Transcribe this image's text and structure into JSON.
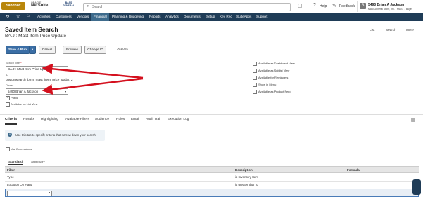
{
  "header": {
    "sandbox_label": "Sandbox",
    "oracle_label": "ORACLE",
    "netsuite_label": "NetSuite",
    "company_logo_text": "BASS GENERAL",
    "search_placeholder": "Search",
    "help_label": "Help",
    "feedback_label": "Feedback",
    "user_name": "5490 Brian A Jackson",
    "user_role": "Mast General Store, Inc. - MAST - Buyer",
    "user_initial": "B"
  },
  "nav": {
    "items": [
      "Activities",
      "Customers",
      "Vendors",
      "Financial",
      "Planning & Budgeting",
      "Reports",
      "Analytics",
      "Documents",
      "Setup",
      "Key Rec",
      "SuiteApps",
      "Support"
    ],
    "active_index": 3
  },
  "page": {
    "heading": "Saved Item Search",
    "record_title": "BA.J : Mast Item Price Update",
    "links": [
      "List",
      "Search",
      "More"
    ]
  },
  "toolbar": {
    "save_run": "Save & Run",
    "caret": "▾",
    "cancel": "Cancel",
    "preview": "Preview",
    "change_id": "Change ID",
    "actions": "Actions"
  },
  "form": {
    "search_title_label": "Search Title",
    "search_title_value": "BA.J : Mast Item Price Update",
    "id_label": "ID",
    "id_value": "customsearch_bmn_mast_item_price_updat_2",
    "owner_label": "Owner",
    "owner_value": "5490 Brian A Jackson",
    "public_label": "Public",
    "public_checked": true,
    "list_view_label": "Available as List View",
    "list_view_checked": false,
    "right_options": [
      "Available as Dashboard View",
      "Available as Sublist View",
      "Available for Reminders",
      "Show in Menu",
      "Available as Product Feed"
    ]
  },
  "tabs": {
    "items": [
      "Criteria",
      "Results",
      "Highlighting",
      "Available Filters",
      "Audience",
      "Roles",
      "Email",
      "Audit Trail",
      "Execution Log"
    ],
    "active_index": 0
  },
  "criteria": {
    "info_text": "Use this tab to specify criteria that narrow down your search.",
    "use_expressions_label": "Use Expressions",
    "subtabs": [
      "Standard",
      "Summary"
    ],
    "columns": [
      "Filter",
      "Description",
      "Formula"
    ],
    "rows": [
      {
        "filter": "Type",
        "description": "is Inventory Item",
        "formula": ""
      },
      {
        "filter": "Location On Hand",
        "description": "is greater than 0",
        "formula": ""
      }
    ]
  },
  "colors": {
    "nav_bg": "#1f3c57",
    "primary_button": "#3b6ea5",
    "annotation_arrow": "#d4101e"
  }
}
